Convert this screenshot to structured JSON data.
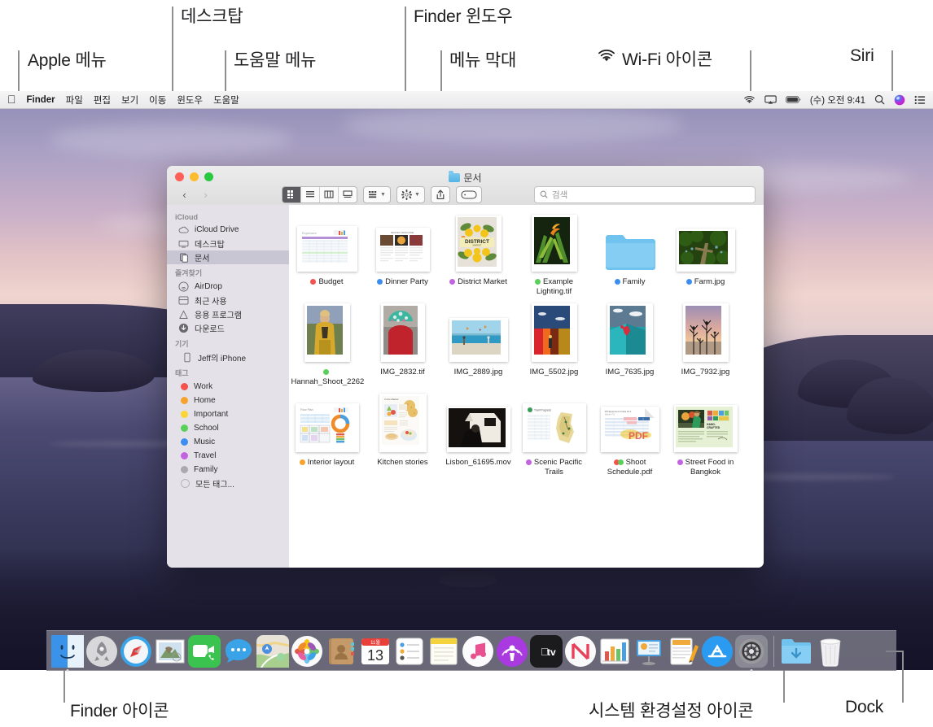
{
  "callouts": [
    {
      "id": "apple-menu",
      "label": "Apple 메뉴"
    },
    {
      "id": "desktop",
      "label": "데스크탑"
    },
    {
      "id": "help-menu",
      "label": "도움말 메뉴"
    },
    {
      "id": "finder-window",
      "label": "Finder 윈도우"
    },
    {
      "id": "menu-bar",
      "label": "메뉴 막대"
    },
    {
      "id": "wifi-icon",
      "label": "Wi-Fi 아이콘"
    },
    {
      "id": "siri",
      "label": "Siri"
    },
    {
      "id": "finder-icon",
      "label": "Finder 아이콘"
    },
    {
      "id": "system-preferences-icon",
      "label": "시스템 환경설정 아이콘"
    },
    {
      "id": "dock",
      "label": "Dock"
    }
  ],
  "menubar": {
    "apple_logo": "apple-icon",
    "items": [
      "Finder",
      "파일",
      "편집",
      "보기",
      "이동",
      "윈도우",
      "도움말"
    ],
    "status": {
      "wifi": "wifi-icon",
      "airplay": "airplay-icon",
      "battery": "battery-icon",
      "clock": "(수) 오전 9:41",
      "search": "search-icon",
      "siri": "siri-icon",
      "control_center": "control-center-icon"
    }
  },
  "finder": {
    "title": "문서",
    "nav": {
      "back": "‹",
      "forward": "›"
    },
    "view_modes": [
      "icon-view",
      "list-view",
      "column-view",
      "gallery-view"
    ],
    "active_view": "icon-view",
    "group_button": "group-by-icon",
    "action_button": "action-gear-icon",
    "share_button": "share-icon",
    "tag_button": "tag-icon",
    "search": {
      "placeholder": "검색",
      "value": ""
    },
    "sidebar": [
      {
        "group": "iCloud",
        "items": [
          {
            "label": "iCloud Drive",
            "icon": "cloud-icon",
            "selected": false
          },
          {
            "label": "데스크탑",
            "icon": "desktop-icon",
            "selected": false
          },
          {
            "label": "문서",
            "icon": "documents-icon",
            "selected": true
          }
        ]
      },
      {
        "group": "즐겨찾기",
        "items": [
          {
            "label": "AirDrop",
            "icon": "airdrop-icon",
            "selected": false
          },
          {
            "label": "최근 사용",
            "icon": "recents-icon",
            "selected": false
          },
          {
            "label": "응용 프로그램",
            "icon": "applications-icon",
            "selected": false
          },
          {
            "label": "다운로드",
            "icon": "downloads-icon",
            "selected": false
          }
        ]
      },
      {
        "group": "기기",
        "items": [
          {
            "label": "Jeff의 iPhone",
            "icon": "iphone-icon",
            "selected": false
          }
        ]
      },
      {
        "group": "태그",
        "items": [
          {
            "label": "Work",
            "color": "#f4524d",
            "selected": false
          },
          {
            "label": "Home",
            "color": "#f7a32b",
            "selected": false
          },
          {
            "label": "Important",
            "color": "#fcd535",
            "selected": false
          },
          {
            "label": "School",
            "color": "#5ad05a",
            "selected": false
          },
          {
            "label": "Music",
            "color": "#3b8ef0",
            "selected": false
          },
          {
            "label": "Travel",
            "color": "#c264e0",
            "selected": false
          },
          {
            "label": "Family",
            "color": "#a9a9ae",
            "selected": false
          },
          {
            "label": "모든 태그...",
            "color": "",
            "selected": false
          }
        ]
      }
    ],
    "files": [
      {
        "name": "Budget",
        "kind": "spreadsheet",
        "tags": [
          "#f4524d"
        ]
      },
      {
        "name": "Dinner Party",
        "kind": "document",
        "tags": [
          "#3b8ef0"
        ]
      },
      {
        "name": "District Market",
        "kind": "poster",
        "tags": [
          "#c264e0"
        ]
      },
      {
        "name": "Example Lighting.tif",
        "kind": "photo-plant",
        "tags": [
          "#5ad05a"
        ]
      },
      {
        "name": "Family",
        "kind": "folder",
        "tags": [
          "#3b8ef0"
        ]
      },
      {
        "name": "Farm.jpg",
        "kind": "photo-farm",
        "tags": [
          "#3b8ef0"
        ]
      },
      {
        "name": "Hannah_Shoot_2262",
        "kind": "photo-portrait",
        "tags": [
          "#5ad05a"
        ]
      },
      {
        "name": "IMG_2832.tif",
        "kind": "photo-hat",
        "tags": []
      },
      {
        "name": "IMG_2889.jpg",
        "kind": "photo-beach",
        "tags": []
      },
      {
        "name": "IMG_5502.jpg",
        "kind": "photo-wall",
        "tags": []
      },
      {
        "name": "IMG_7635.jpg",
        "kind": "photo-jump",
        "tags": []
      },
      {
        "name": "IMG_7932.jpg",
        "kind": "photo-sunset",
        "tags": []
      },
      {
        "name": "Interior layout",
        "kind": "chart-doc",
        "tags": [
          "#f7a32b"
        ]
      },
      {
        "name": "Kitchen stories",
        "kind": "magazine",
        "tags": []
      },
      {
        "name": "Lisbon_61695.mov",
        "kind": "video",
        "tags": []
      },
      {
        "name": "Scenic Pacific Trails",
        "kind": "map-doc",
        "tags": [
          "#c264e0"
        ]
      },
      {
        "name": "Shoot Schedule.pdf",
        "kind": "pdf",
        "tags": [
          "#f4524d",
          "#5ad05a"
        ]
      },
      {
        "name": "Street Food in Bangkok",
        "kind": "brochure",
        "tags": [
          "#c264e0"
        ]
      }
    ]
  },
  "dock": {
    "apps": [
      {
        "name": "Finder",
        "icon": "finder-icon",
        "running": true
      },
      {
        "name": "Launchpad",
        "icon": "launchpad-icon",
        "running": false
      },
      {
        "name": "Safari",
        "icon": "safari-icon",
        "running": false
      },
      {
        "name": "Mail",
        "icon": "mail-icon",
        "running": false
      },
      {
        "name": "FaceTime",
        "icon": "facetime-icon",
        "running": false
      },
      {
        "name": "Messages",
        "icon": "messages-icon",
        "running": false
      },
      {
        "name": "Maps",
        "icon": "maps-icon",
        "running": false
      },
      {
        "name": "Photos",
        "icon": "photos-icon",
        "running": false
      },
      {
        "name": "Contacts",
        "icon": "contacts-icon",
        "running": false
      },
      {
        "name": "Calendar",
        "icon": "calendar-icon",
        "running": false
      },
      {
        "name": "Reminders",
        "icon": "reminders-icon",
        "running": false
      },
      {
        "name": "Notes",
        "icon": "notes-icon",
        "running": false
      },
      {
        "name": "iTunes",
        "icon": "itunes-icon",
        "running": false
      },
      {
        "name": "Podcasts",
        "icon": "podcasts-icon",
        "running": false
      },
      {
        "name": "Apple TV",
        "icon": "appletv-icon",
        "running": false
      },
      {
        "name": "News",
        "icon": "news-icon",
        "running": false
      },
      {
        "name": "Numbers",
        "icon": "numbers-icon",
        "running": false
      },
      {
        "name": "Keynote",
        "icon": "keynote-icon",
        "running": false
      },
      {
        "name": "Pages",
        "icon": "pages-icon",
        "running": false
      },
      {
        "name": "App Store",
        "icon": "appstore-icon",
        "running": false
      },
      {
        "name": "System Preferences",
        "icon": "system-preferences-icon",
        "running": false
      }
    ],
    "others": [
      {
        "name": "Downloads",
        "icon": "downloads-folder-icon"
      },
      {
        "name": "Trash",
        "icon": "trash-icon"
      }
    ],
    "calendar": {
      "month": "11월",
      "day": "13"
    }
  }
}
